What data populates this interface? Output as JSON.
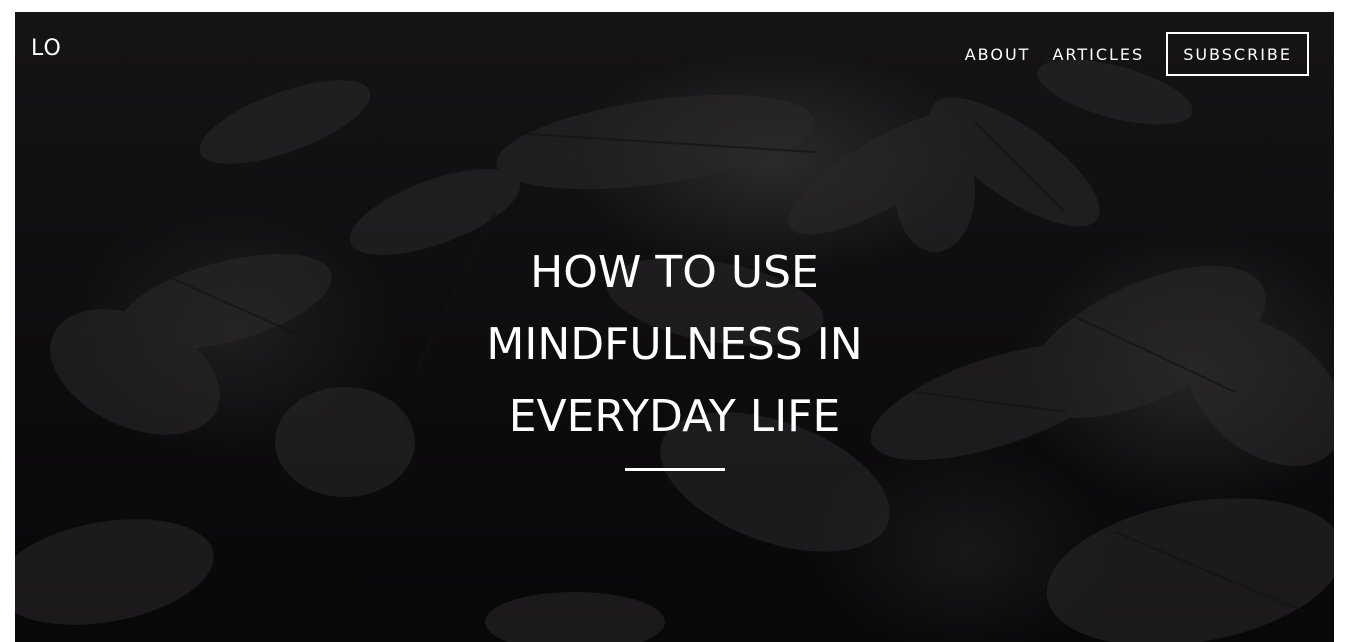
{
  "header": {
    "logo": "LO",
    "nav": {
      "about": "ABOUT",
      "articles": "ARTICLES",
      "subscribe": "SUBSCRIBE"
    }
  },
  "hero": {
    "title_lines": [
      "HOW TO USE",
      "MINDFULNESS IN",
      "EVERYDAY LIFE"
    ],
    "background": "dark-foliage-photo"
  },
  "colors": {
    "text": "#ffffff",
    "background": "#121113",
    "page": "#ffffff"
  }
}
